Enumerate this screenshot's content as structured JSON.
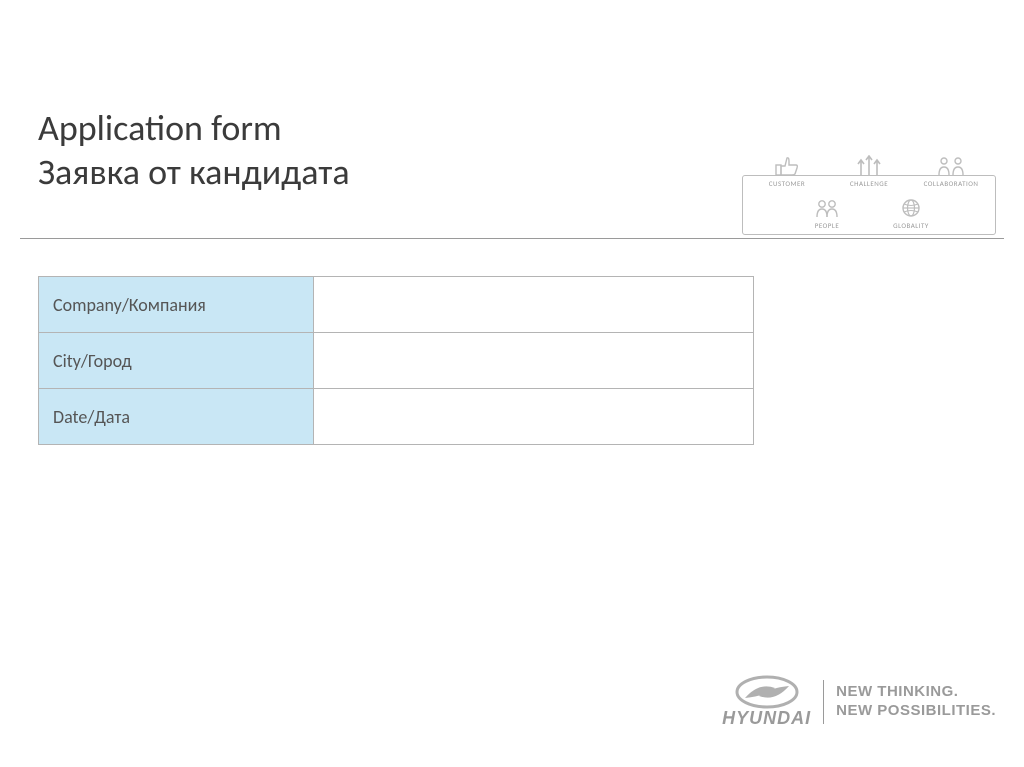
{
  "title": {
    "en": "Application form",
    "ru": "Заявка от кандидата"
  },
  "form": {
    "rows": [
      {
        "label": "Company/Компания",
        "value": ""
      },
      {
        "label": "City/Город",
        "value": ""
      },
      {
        "label": "Date/Дата",
        "value": ""
      }
    ]
  },
  "core_values": {
    "items": [
      {
        "key": "customer",
        "label": "CUSTOMER"
      },
      {
        "key": "challenge",
        "label": "CHALLENGE"
      },
      {
        "key": "collaboration",
        "label": "COLLABORATION"
      },
      {
        "key": "people",
        "label": "PEOPLE"
      },
      {
        "key": "globality",
        "label": "GLOBALITY"
      }
    ]
  },
  "brand": {
    "name": "HYUNDAI",
    "tagline_1": "NEW THINKING.",
    "tagline_2": "NEW POSSIBILITIES."
  }
}
